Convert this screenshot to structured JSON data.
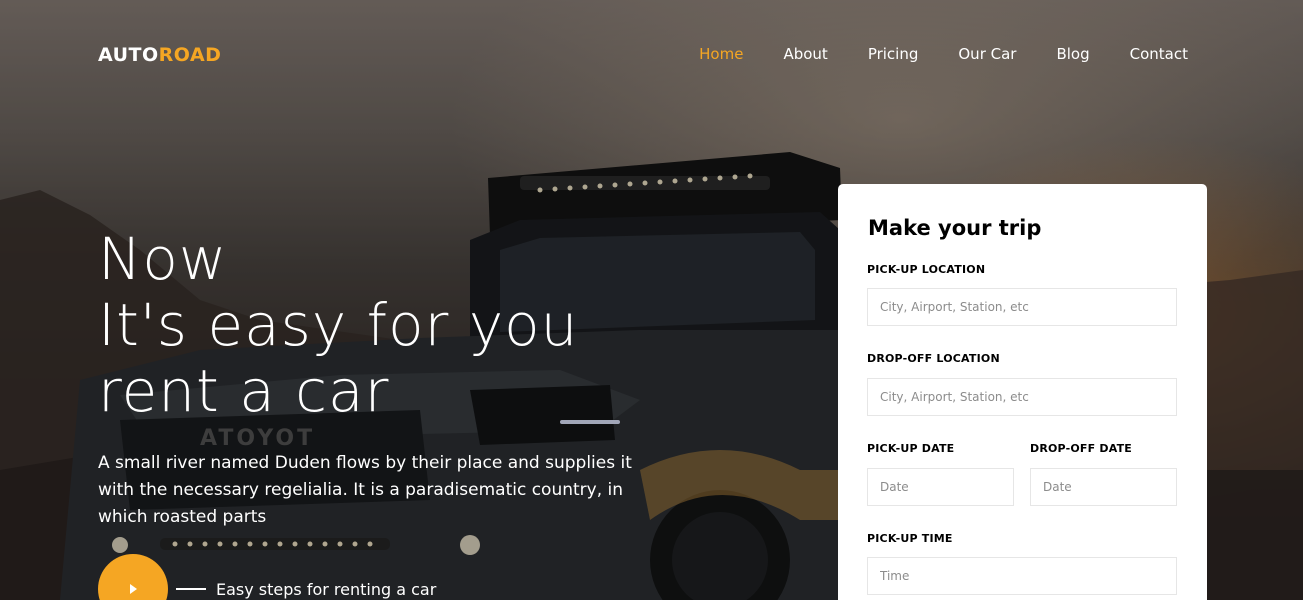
{
  "brand": {
    "part1": "AUTO",
    "part2": "ROAD"
  },
  "nav": {
    "items": [
      {
        "label": "Home",
        "active": true
      },
      {
        "label": "About",
        "active": false
      },
      {
        "label": "Pricing",
        "active": false
      },
      {
        "label": "Our Car",
        "active": false
      },
      {
        "label": "Blog",
        "active": false
      },
      {
        "label": "Contact",
        "active": false
      }
    ]
  },
  "hero": {
    "headline_line1": "Now",
    "headline_line2": "It's easy for you",
    "headline_line3": "rent a car",
    "subtext": "A small river named Duden flows by their place and supplies it with the necessary regelialia. It is a paradisematic country, in which roasted parts",
    "video_label": "Easy steps for renting a car",
    "play_icon": "play-icon"
  },
  "form": {
    "title": "Make your trip",
    "pickup_location_label": "PICK-UP LOCATION",
    "pickup_location_placeholder": "City, Airport, Station, etc",
    "dropoff_location_label": "DROP-OFF LOCATION",
    "dropoff_location_placeholder": "City, Airport, Station, etc",
    "pickup_date_label": "PICK-UP DATE",
    "pickup_date_placeholder": "Date",
    "dropoff_date_label": "DROP-OFF DATE",
    "dropoff_date_placeholder": "Date",
    "pickup_time_label": "PICK-UP TIME",
    "pickup_time_placeholder": "Time"
  },
  "colors": {
    "accent": "#f5a623",
    "text_light": "#ffffff",
    "card_bg": "#ffffff"
  }
}
